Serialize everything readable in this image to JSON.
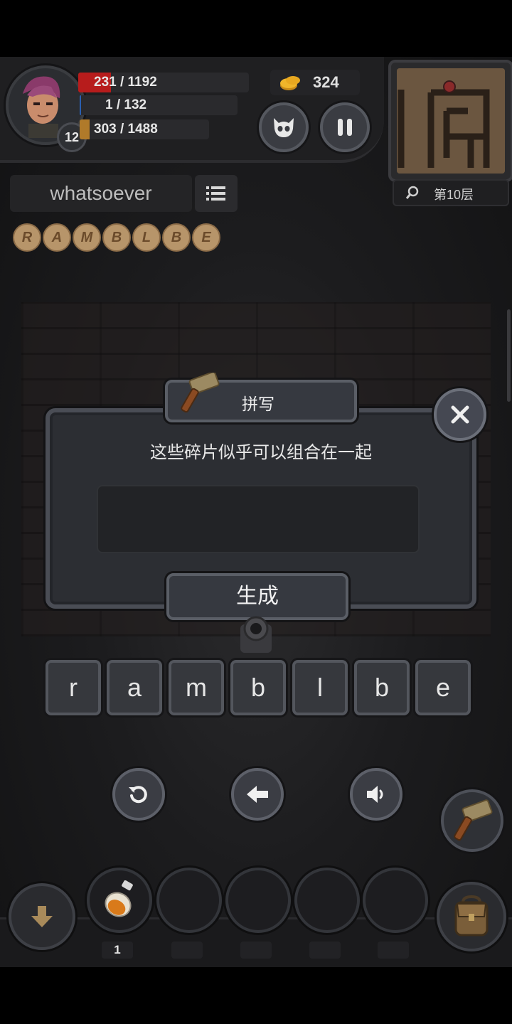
{
  "hud": {
    "level": "12",
    "hp": "231 / 1192",
    "hp_fraction": 0.19,
    "mp": "1 / 132",
    "mp_fraction": 0.01,
    "xp": "303 / 1488",
    "xp_fraction": 0.2,
    "gold": "324",
    "floor": "第10层"
  },
  "word": {
    "target": "whatsoever",
    "fragments": [
      "R",
      "A",
      "M",
      "B",
      "L",
      "B",
      "E"
    ]
  },
  "dialog": {
    "title": "拼写",
    "message": "这些碎片似乎可以组合在一起",
    "input_value": "",
    "generate_label": "生成"
  },
  "letters": [
    "r",
    "a",
    "m",
    "b",
    "l",
    "b",
    "e"
  ],
  "inventory": {
    "slot1_count": "1"
  },
  "colors": {
    "hp": "#b71c1c",
    "xp": "#b07a2a",
    "gold": "#e0a020"
  },
  "icons": [
    "avatar",
    "coin-icon",
    "monster-face-icon",
    "pause-icon",
    "search-icon",
    "list-icon",
    "hammer-icon",
    "close-icon",
    "undo-icon",
    "backspace-icon",
    "speaker-icon",
    "down-arrow-icon",
    "potion-icon",
    "backpack-icon"
  ]
}
